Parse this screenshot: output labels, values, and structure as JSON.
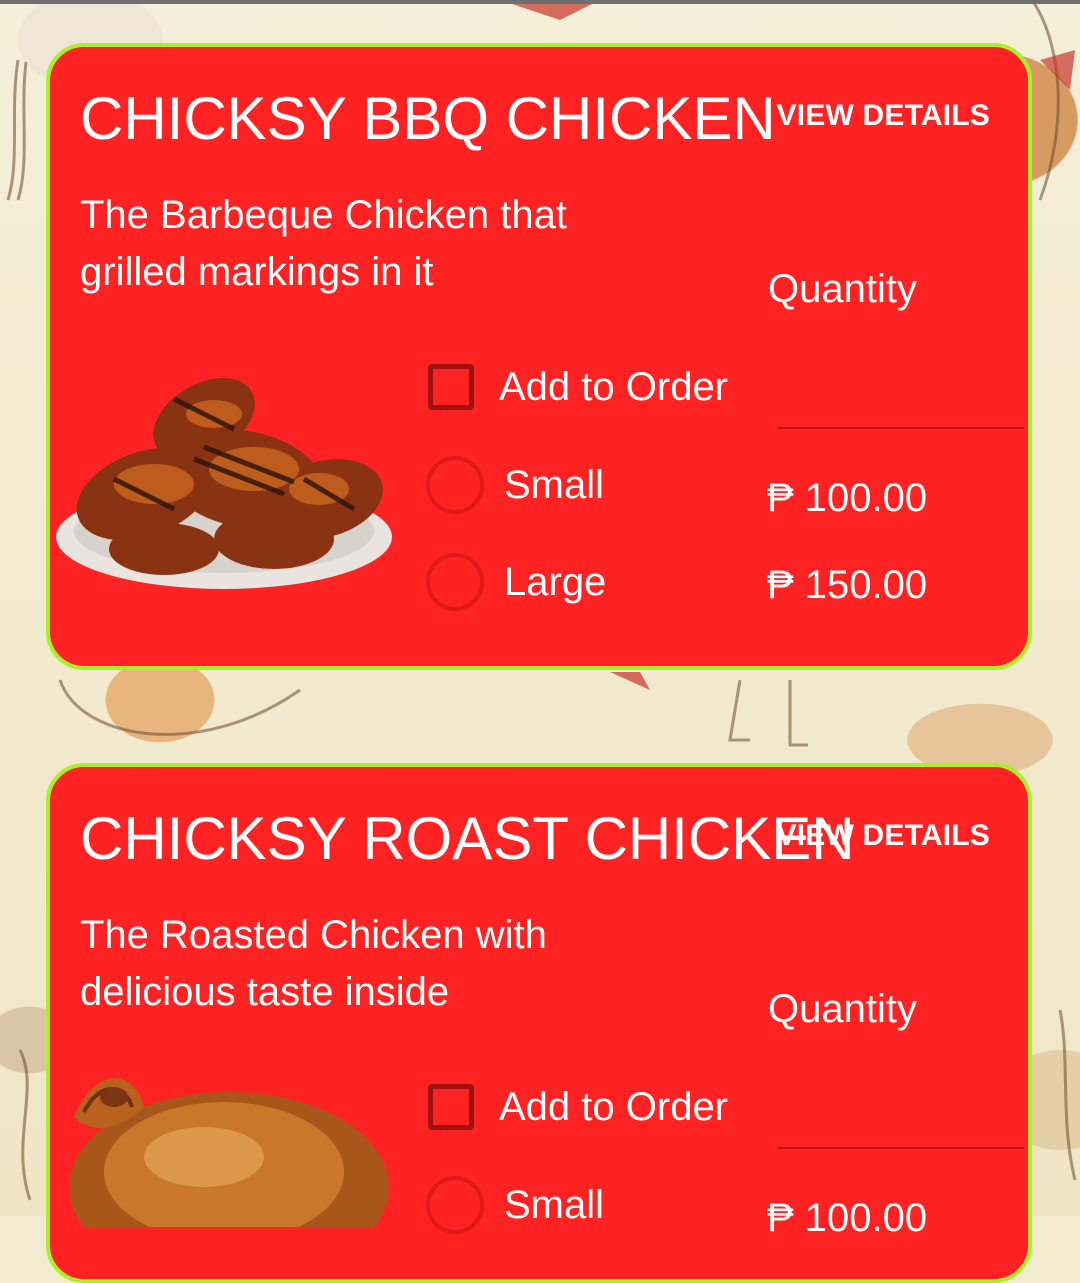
{
  "colors": {
    "card_background": "#fe2222",
    "card_border": "#a8f12a",
    "text": "#ffffff",
    "page_background": "#f3ebcf"
  },
  "products": [
    {
      "title": "CHICKSY BBQ CHICKEN",
      "view_details": "VIEW DETAILS",
      "description": "The Barbeque Chicken that grilled markings in it",
      "quantity_label": "Quantity",
      "quantity_value": "",
      "add_to_order": "Add to Order",
      "add_to_order_checked": false,
      "image_icon": "bbq-chicken-photo",
      "options": [
        {
          "label": "Small",
          "price": "₱ 100.00",
          "selected": false
        },
        {
          "label": "Large",
          "price": "₱ 150.00",
          "selected": false
        }
      ]
    },
    {
      "title": "CHICKSY ROAST CHICKEN",
      "view_details": "VIEW DETAILS",
      "description": "The Roasted Chicken with delicious taste inside",
      "quantity_label": "Quantity",
      "quantity_value": "",
      "add_to_order": "Add to Order",
      "add_to_order_checked": false,
      "image_icon": "roast-chicken-photo",
      "options": [
        {
          "label": "Small",
          "price": "₱ 100.00",
          "selected": false
        }
      ]
    }
  ]
}
